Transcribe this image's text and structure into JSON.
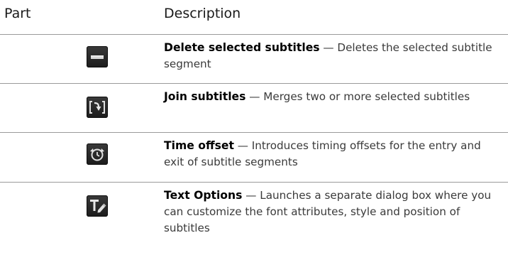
{
  "header": {
    "part_label": "Part",
    "description_label": "Description"
  },
  "rows": [
    {
      "icon": "delete-subtitle-icon",
      "term": "Delete selected subtitles",
      "separator": " — ",
      "description": "Deletes the selected subtitle segment"
    },
    {
      "icon": "join-subtitles-icon",
      "term": "Join subtitles",
      "separator": " — ",
      "description": "Merges two or more selected subtitles"
    },
    {
      "icon": "time-offset-icon",
      "term": "Time offset",
      "separator": " — ",
      "description": "Introduces timing offsets for the entry and exit of subtitle segments"
    },
    {
      "icon": "text-options-icon",
      "term": "Text Options",
      "separator": " — ",
      "description": "Launches a separate dialog box where you can customize the font attributes, style and position of subtitles"
    }
  ],
  "colors": {
    "icon_background": "#262626",
    "icon_glyph": "#e6e6e6",
    "rule": "#9a9a9a",
    "term_text": "#000000"
  }
}
